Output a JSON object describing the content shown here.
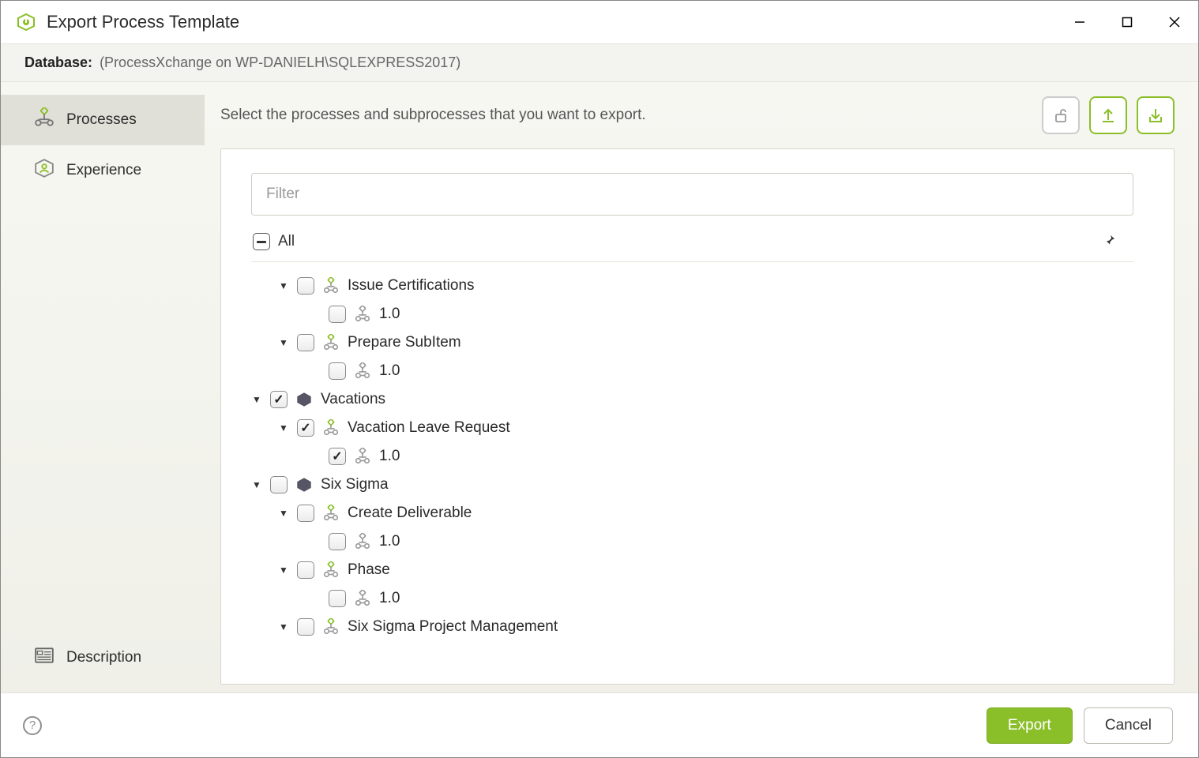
{
  "window": {
    "title": "Export Process Template"
  },
  "database": {
    "label": "Database:",
    "value": "(ProcessXchange on WP-DANIELH\\SQLEXPRESS2017)"
  },
  "sidebar": {
    "processes": "Processes",
    "experience": "Experience",
    "description": "Description"
  },
  "main": {
    "instruction": "Select the processes and subprocesses that you want to export.",
    "filter_placeholder": "Filter",
    "all_label": "All"
  },
  "tree": {
    "items": [
      {
        "indent": 1,
        "expandable": true,
        "checked": false,
        "icon": "process",
        "label": "Issue Certifications"
      },
      {
        "indent": 2,
        "expandable": false,
        "checked": false,
        "icon": "version",
        "label": "1.0"
      },
      {
        "indent": 1,
        "expandable": true,
        "checked": false,
        "icon": "process",
        "label": "Prepare SubItem"
      },
      {
        "indent": 2,
        "expandable": false,
        "checked": false,
        "icon": "version",
        "label": "1.0"
      },
      {
        "indent": 0,
        "expandable": true,
        "checked": true,
        "icon": "folder",
        "label": "Vacations"
      },
      {
        "indent": 1,
        "expandable": true,
        "checked": true,
        "icon": "process",
        "label": "Vacation Leave Request"
      },
      {
        "indent": 2,
        "expandable": false,
        "checked": true,
        "icon": "version",
        "label": "1.0"
      },
      {
        "indent": 0,
        "expandable": true,
        "checked": false,
        "icon": "folder",
        "label": "Six Sigma"
      },
      {
        "indent": 1,
        "expandable": true,
        "checked": false,
        "icon": "process",
        "label": "Create Deliverable"
      },
      {
        "indent": 2,
        "expandable": false,
        "checked": false,
        "icon": "version",
        "label": "1.0"
      },
      {
        "indent": 1,
        "expandable": true,
        "checked": false,
        "icon": "process",
        "label": "Phase"
      },
      {
        "indent": 2,
        "expandable": false,
        "checked": false,
        "icon": "version",
        "label": "1.0"
      },
      {
        "indent": 1,
        "expandable": true,
        "checked": false,
        "icon": "process",
        "label": "Six Sigma Project Management"
      }
    ]
  },
  "footer": {
    "export": "Export",
    "cancel": "Cancel"
  }
}
